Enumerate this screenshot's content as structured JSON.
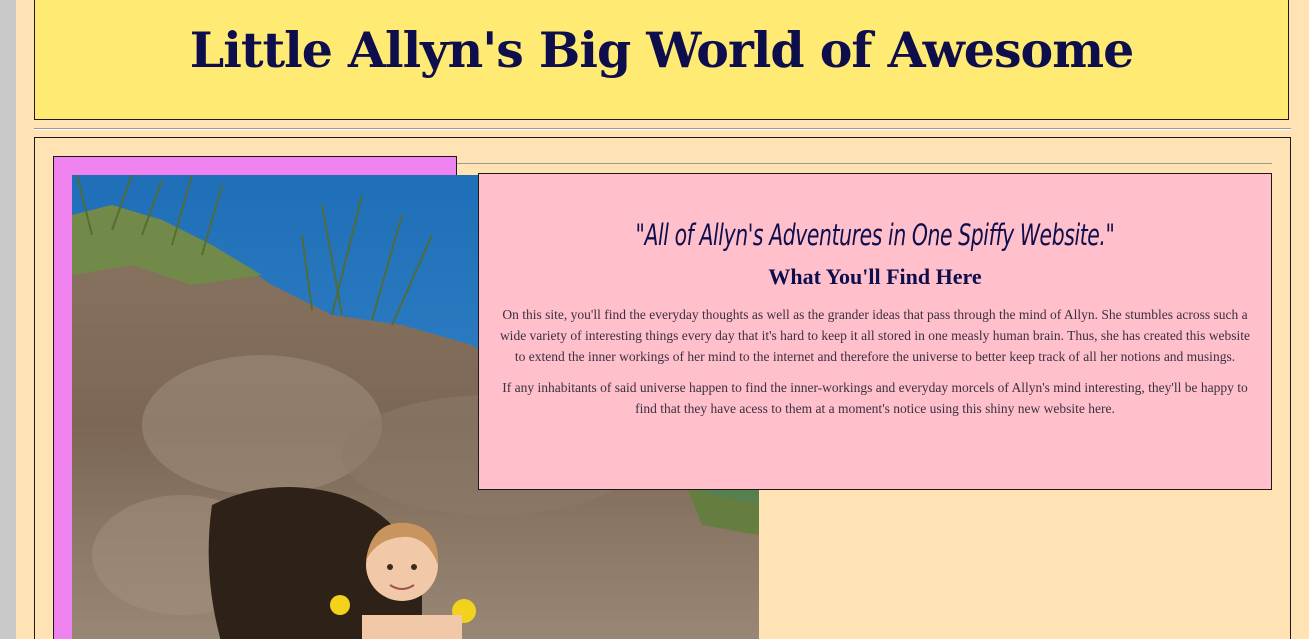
{
  "header": {
    "title": "Little Allyn's Big World of Awesome"
  },
  "intro": {
    "tagline": "\"All of Allyn's Adventures in One Spiffy Website.\"",
    "heading": "What You'll Find Here",
    "paragraph_1": "On this site, you'll find the everyday thoughts as well as the grander ideas that pass through the mind of Allyn. She stumbles across such a wide variety of interesting things every day that it's hard to keep it all stored in one measly human brain. Thus, she has created this website to extend the inner workings of her mind to the internet and therefore the universe to better keep track of all her notions and musings.",
    "paragraph_2": "If any inhabitants of said universe happen to find the inner-workings and everyday morcels of Allyn's mind interesting, they'll be happy to find that they have acess to them at a moment's notice using this shiny new website here."
  },
  "colors": {
    "page_background": "#ffe3b5",
    "header_background": "#ffeb73",
    "title_color": "#0e0e4d",
    "photo_frame": "#ee82ee",
    "panel_background": "#ffc0cb"
  }
}
